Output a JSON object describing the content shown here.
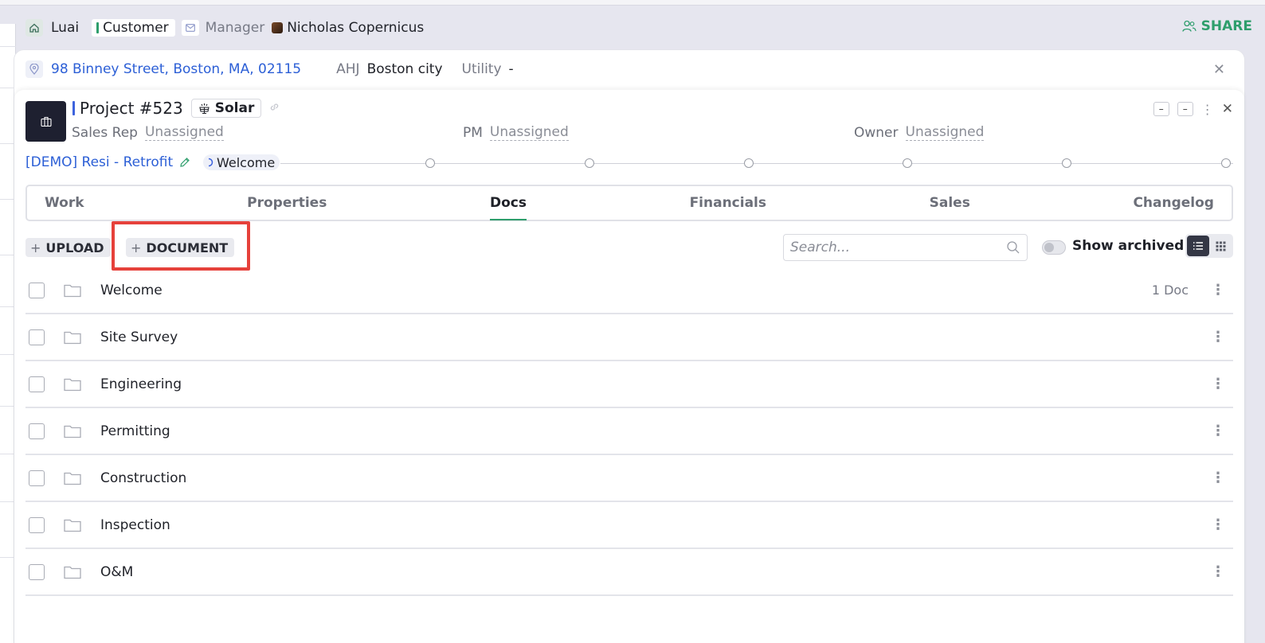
{
  "header": {
    "user_name": "Luai",
    "customer_label": "Customer",
    "manager_label": "Manager",
    "manager_name": "Nicholas Copernicus",
    "share_label": "SHARE"
  },
  "address_bar": {
    "address": "98 Binney Street, Boston, MA, 02115",
    "ahj_label": "AHJ",
    "ahj_value": "Boston city",
    "utility_label": "Utility",
    "utility_value": "-"
  },
  "project": {
    "title": "Project #523",
    "type_badge": "Solar",
    "sales_rep_label": "Sales Rep",
    "sales_rep_value": "Unassigned",
    "pm_label": "PM",
    "pm_value": "Unassigned",
    "owner_label": "Owner",
    "owner_value": "Unassigned"
  },
  "workflow": {
    "template_name": "[DEMO] Resi - Retrofit",
    "current_stage": "Welcome"
  },
  "tabs": [
    {
      "label": "Work"
    },
    {
      "label": "Properties"
    },
    {
      "label": "Docs"
    },
    {
      "label": "Financials"
    },
    {
      "label": "Sales"
    },
    {
      "label": "Changelog"
    }
  ],
  "toolbar": {
    "upload_label": "UPLOAD",
    "document_label": "DOCUMENT",
    "search_placeholder": "Search...",
    "show_archived_label": "Show archived"
  },
  "folders": [
    {
      "name": "Welcome",
      "count": "1 Doc"
    },
    {
      "name": "Site Survey",
      "count": ""
    },
    {
      "name": "Engineering",
      "count": ""
    },
    {
      "name": "Permitting",
      "count": ""
    },
    {
      "name": "Construction",
      "count": ""
    },
    {
      "name": "Inspection",
      "count": ""
    },
    {
      "name": "O&M",
      "count": ""
    }
  ],
  "colors": {
    "accent_green": "#2e9e6c",
    "link_blue": "#2c5fd6",
    "highlight_red": "#e6413b"
  }
}
